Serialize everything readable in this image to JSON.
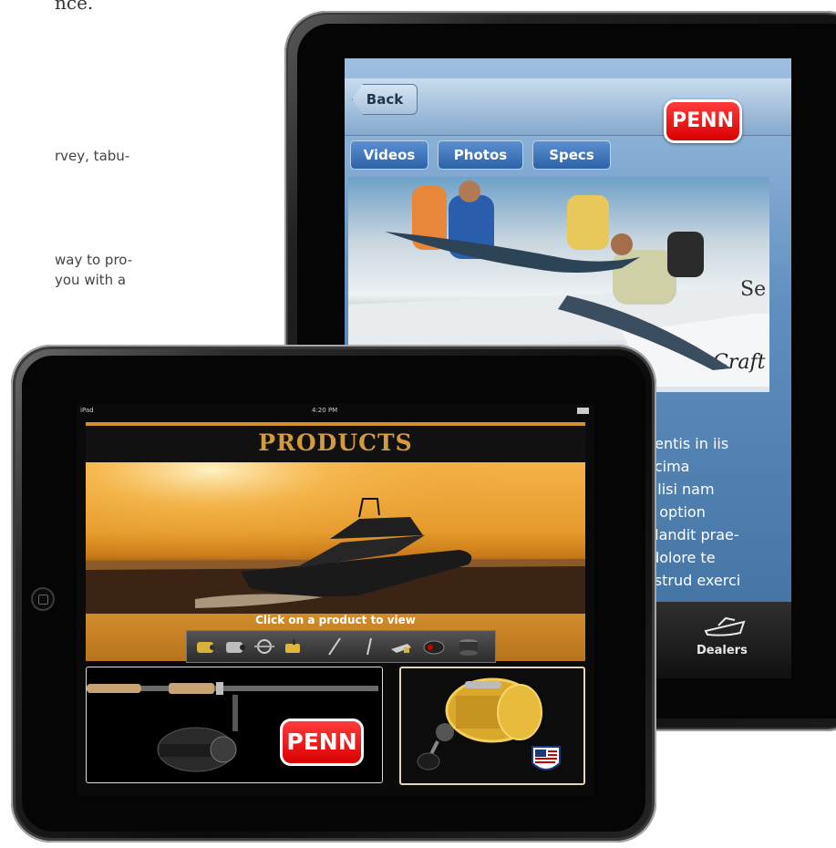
{
  "background_text": {
    "line1": "nce.",
    "line2": "rvey, tabu-",
    "line3": "way to pro-",
    "line4": "you with a"
  },
  "back_ipad": {
    "nav": {
      "back_label": "Back",
      "logo_text": "PENN"
    },
    "segments": [
      "Videos",
      "Photos",
      "Specs"
    ],
    "body_text": "gentis in iis\necima\ncilisi nam\nd option\nblandit prae-\n dolore te\nostrud exerci",
    "tab_bar": {
      "dealers_label": "Dealers"
    }
  },
  "front_ipad": {
    "status_bar": {
      "device": "iPad",
      "time": "4:20 PM"
    },
    "title": "PRODUCTS",
    "hint": "Click on a product to view",
    "tiles": {
      "rod_logo": "PENN"
    }
  },
  "colors": {
    "accent_gold": "#d49a3e",
    "penn_red": "#d90000",
    "ios_blue": "#2d62a7"
  }
}
